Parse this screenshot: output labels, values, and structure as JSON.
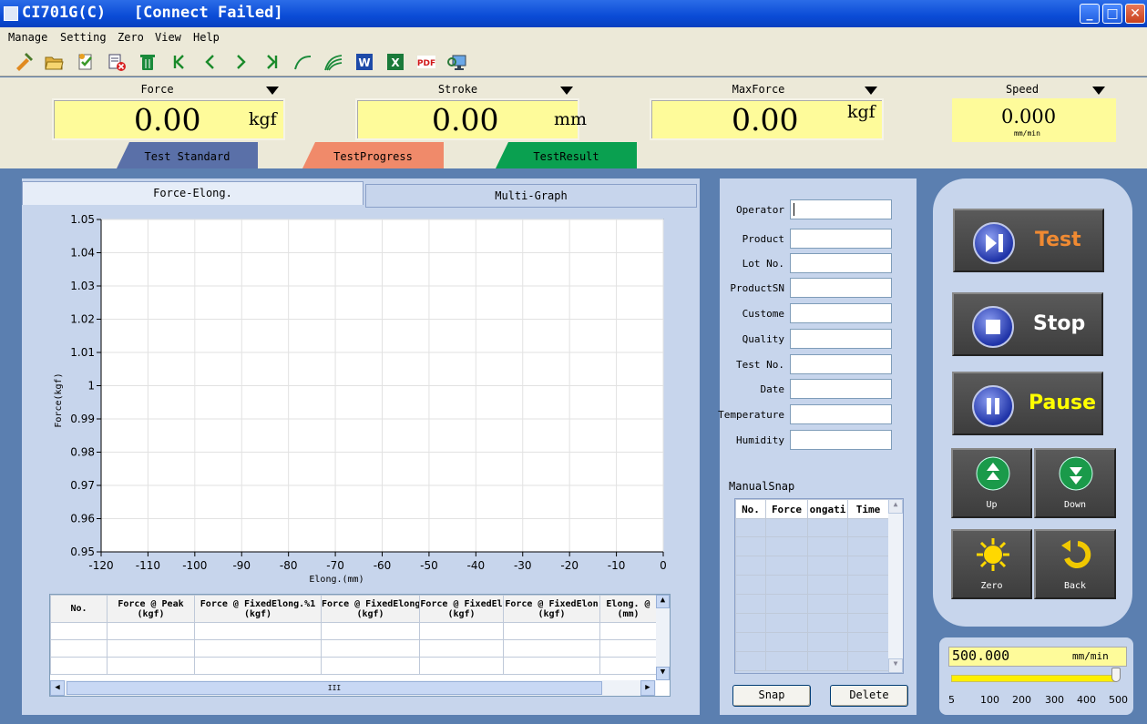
{
  "window": {
    "app_name": "CI701G(C)",
    "status": "[Connect Failed]",
    "controls": {
      "minimize": "_",
      "maximize": "□",
      "close": "✕"
    }
  },
  "menu": [
    "Manage",
    "Setting",
    "Zero",
    "View",
    "Help"
  ],
  "toolbar_icons": [
    "tools-icon",
    "open-folder-icon",
    "checklist-icon",
    "delete-file-icon",
    "trash-icon",
    "first-icon",
    "prev-icon",
    "next-icon",
    "last-icon",
    "curve-icon",
    "multi-curve-icon",
    "word-icon",
    "excel-icon",
    "pdf-icon",
    "monitor-icon"
  ],
  "readouts": {
    "force": {
      "label": "Force",
      "value": "0.00",
      "unit": "kgf"
    },
    "stroke": {
      "label": "Stroke",
      "value": "0.00",
      "unit": "mm"
    },
    "maxforce": {
      "label": "MaxForce",
      "value": "0.00",
      "unit": "kgf"
    },
    "speed": {
      "label": "Speed",
      "value": "0.000",
      "unit": "mm/min"
    }
  },
  "section_tabs": [
    {
      "label": "Test Standard",
      "color": "#5a70a8"
    },
    {
      "label": "TestProgress",
      "color": "#f08a6a"
    },
    {
      "label": "TestResult",
      "color": "#0aa050"
    }
  ],
  "chart_tabs": [
    "Force-Elong.",
    "Multi-Graph"
  ],
  "chart_data": {
    "type": "line",
    "xlabel": "Elong.(mm)",
    "ylabel": "Force(kgf)",
    "xlim": [
      -120,
      0
    ],
    "ylim": [
      0.95,
      1.05
    ],
    "x_ticks": [
      "-120",
      "-110",
      "-100",
      "-90",
      "-80",
      "-70",
      "-60",
      "-50",
      "-40",
      "-30",
      "-20",
      "-10",
      "0"
    ],
    "y_ticks": [
      "1.05",
      "1.04",
      "1.03",
      "1.02",
      "1.01",
      "1",
      "0.99",
      "0.98",
      "0.97",
      "0.96",
      "0.95"
    ],
    "grid": true,
    "series": []
  },
  "results_table": {
    "columns": [
      {
        "l1": "No.",
        "l2": ""
      },
      {
        "l1": "Force @ Peak",
        "l2": "(kgf)"
      },
      {
        "l1": "Force @ FixedElong.%1",
        "l2": "(kgf)"
      },
      {
        "l1": "Force @ FixedElong",
        "l2": "(kgf)"
      },
      {
        "l1": "Force @ FixedEl",
        "l2": "(kgf)"
      },
      {
        "l1": "Force @ FixedElon",
        "l2": "(kgf)"
      },
      {
        "l1": "Elong. @",
        "l2": "(mm)"
      }
    ],
    "h_scroll_grip": "III"
  },
  "form": {
    "fields": [
      "Operator",
      "Product",
      "Lot No.",
      "ProductSN",
      "Custome",
      "Quality",
      "Test No.",
      "Date",
      "Temperature",
      "Humidity"
    ]
  },
  "snap": {
    "title": "ManualSnap",
    "columns": [
      "No.",
      "Force",
      "ongati",
      "Time"
    ],
    "snap_label": "Snap",
    "delete_label": "Delete"
  },
  "controls": {
    "test": "Test",
    "stop": "Stop",
    "pause": "Pause",
    "up": "Up",
    "down": "Down",
    "zero": "Zero",
    "back": "Back",
    "colors": {
      "test": "#f08a32",
      "stop": "#ffffff",
      "pause": "#ffff00"
    }
  },
  "speed_set": {
    "value": "500.000",
    "unit": "mm/min",
    "slider_level": 1.0,
    "ticks": [
      "5",
      "100",
      "200",
      "300",
      "400",
      "500"
    ]
  }
}
